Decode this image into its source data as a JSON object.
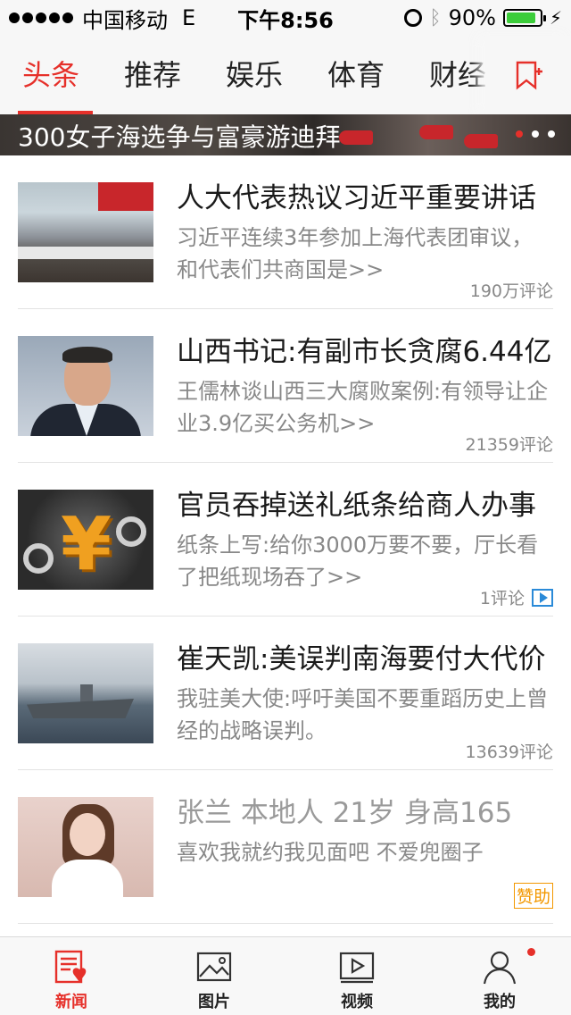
{
  "status_bar": {
    "carrier": "中国移动",
    "network": "E",
    "time": "下午8:56",
    "battery_text": "90%",
    "battery_level": 0.9,
    "icons": [
      "signal-dots-icon",
      "alarm-icon",
      "bluetooth-icon",
      "battery-icon",
      "charging-icon"
    ]
  },
  "tabs": [
    {
      "label": "头条",
      "active": true
    },
    {
      "label": "推荐",
      "active": false
    },
    {
      "label": "娱乐",
      "active": false
    },
    {
      "label": "体育",
      "active": false
    },
    {
      "label": "财经",
      "active": false
    }
  ],
  "tab_add_icon": "bookmark-plus-icon",
  "banner": {
    "title": "300女子海选争与富豪游迪拜",
    "page_count": 3,
    "current_page": 1
  },
  "news": [
    {
      "title": "人大代表热议习近平重要讲话",
      "desc": "习近平连续3年参加上海代表团审议，和代表们共商国是>>",
      "comments": "190万评论",
      "video": false
    },
    {
      "title": "山西书记:有副市长贪腐6.44亿",
      "desc": "王儒林谈山西三大腐败案例:有领导让企业3.9亿买公务机>>",
      "comments": "21359评论",
      "video": false
    },
    {
      "title": "官员吞掉送礼纸条给商人办事",
      "desc": "纸条上写:给你3000万要不要，厅长看了把纸现场吞了>>",
      "comments": "1评论",
      "video": true
    },
    {
      "title": "崔天凯:美误判南海要付大代价",
      "desc": "我驻美大使:呼吁美国不要重蹈历史上曾经的战略误判。",
      "comments": "13639评论",
      "video": false
    }
  ],
  "ad": {
    "title": "张兰 本地人 21岁 身高165",
    "desc": "喜欢我就约我见面吧 不爱兜圈子",
    "badge": "赞助"
  },
  "bottom_nav": [
    {
      "label": "新闻",
      "icon": "news-icon",
      "active": true
    },
    {
      "label": "图片",
      "icon": "picture-icon",
      "active": false
    },
    {
      "label": "视频",
      "icon": "video-icon",
      "active": false
    },
    {
      "label": "我的",
      "icon": "profile-icon",
      "active": false,
      "badge_dot": true
    }
  ],
  "colors": {
    "accent": "#e6302a",
    "ad_badge": "#f39800",
    "video_mark": "#2a8ad8"
  }
}
